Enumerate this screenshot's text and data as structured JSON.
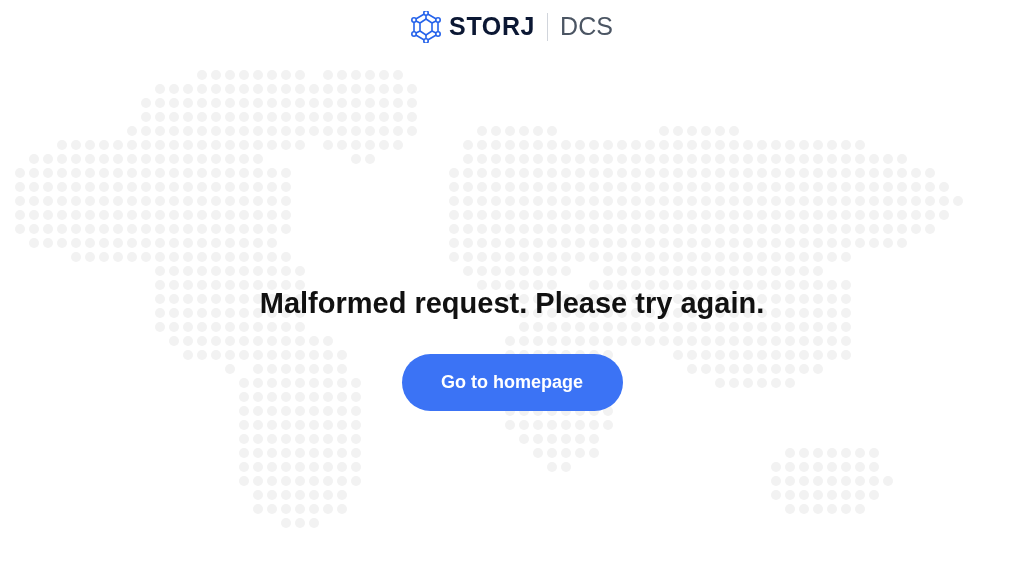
{
  "logo": {
    "brand": "STORJ",
    "product": "DCS"
  },
  "message": "Malformed request. Please try again.",
  "button": {
    "label": "Go to homepage"
  }
}
